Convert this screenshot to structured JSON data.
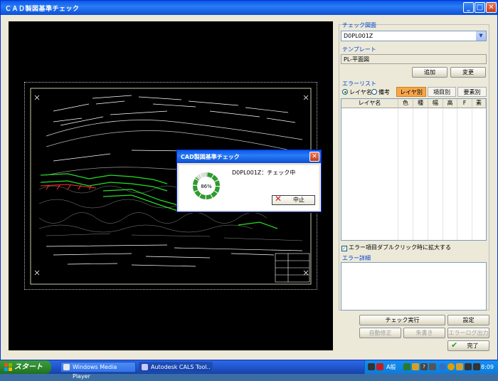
{
  "window": {
    "title": "ＣＡＤ製図基準チェック",
    "minimize": "_",
    "maximize": "□",
    "close": "✕"
  },
  "right_panel": {
    "check_drawing_label": "チェック図面",
    "check_drawing_value": "D0PL001Z",
    "template_label": "テンプレート",
    "template_value": "PL-平面図",
    "add_button": "追加",
    "change_button": "変更",
    "error_list_label": "エラーリスト",
    "radio_layer": "レイヤ名",
    "radio_note": "備考",
    "tabs": [
      "レイヤ別",
      "項目別",
      "要素別"
    ],
    "active_tab": 0,
    "columns": [
      "レイヤ名",
      "色",
      "種",
      "幅",
      "高",
      "F",
      "素"
    ],
    "zoom_checkbox": "エラー項目ダブルクリック時に拡大する",
    "error_detail_label": "エラー詳細",
    "buttons": {
      "run_check": "チェック実行",
      "settings": "設定",
      "auto_fix": "自動修正",
      "annotate": "朱書き",
      "error_log": "エラーログ出力",
      "done": "完了"
    }
  },
  "dialog": {
    "title": "CAD製図基準チェック",
    "close": "✕",
    "message": "D0PL001Z：チェック中",
    "progress_percent": 86,
    "progress_label": "86%",
    "stop_button": "中止"
  },
  "taskbar": {
    "start": "スタート",
    "tasks": [
      "Windows Media Player",
      "Autodesk CALS Tool.."
    ],
    "active_task": 1,
    "ime": "A般",
    "clock": "8:09"
  },
  "colors": {
    "title_blue": "#0a58e8",
    "active_tab": "#f5a64a",
    "progress_green": "#2e9a2e",
    "start_green": "#2f8a2f"
  }
}
